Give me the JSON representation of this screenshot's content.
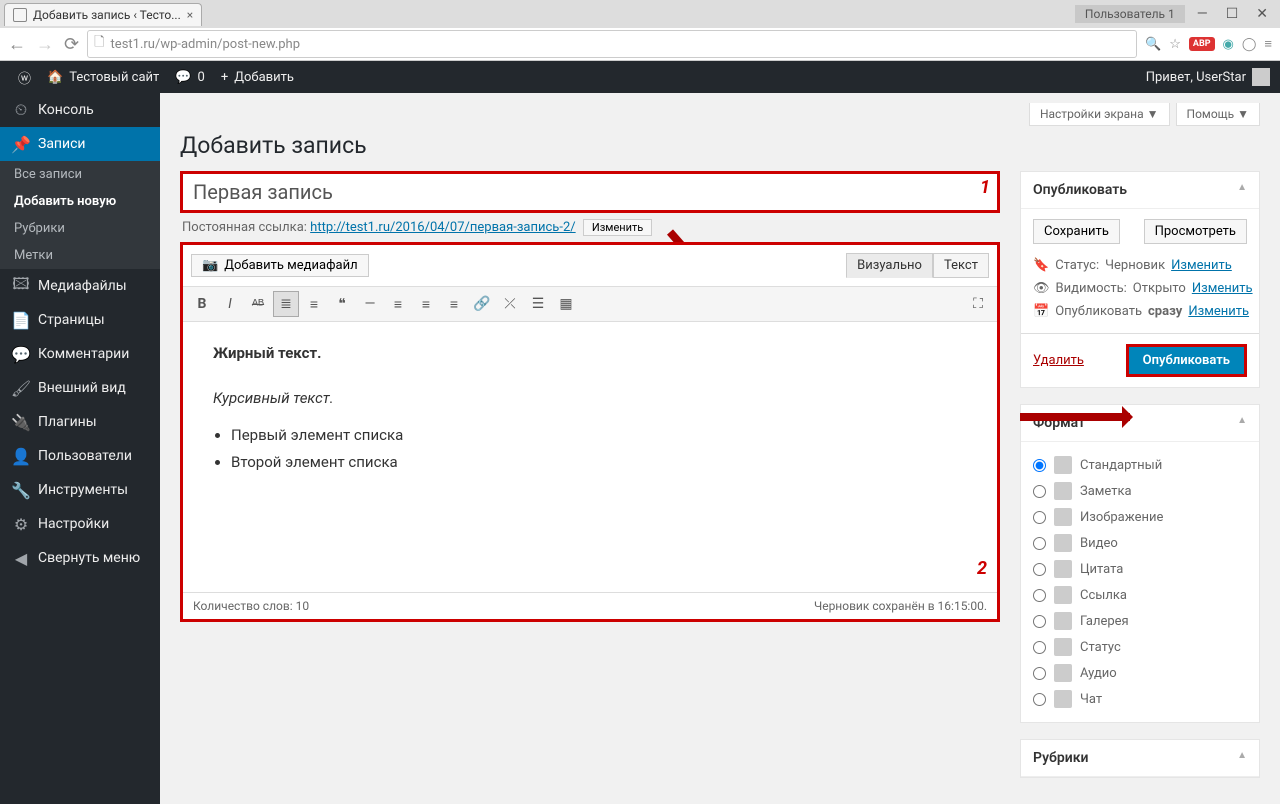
{
  "browser": {
    "tab_title": "Добавить запись ‹ Тесто...",
    "user_badge": "Пользователь 1",
    "url": "test1.ru/wp-admin/post-new.php"
  },
  "adminbar": {
    "site_name": "Тестовый сайт",
    "comments": "0",
    "add": "Добавить",
    "greeting": "Привет, UserStar"
  },
  "sidebar": {
    "items": [
      {
        "label": "Консоль"
      },
      {
        "label": "Записи"
      },
      {
        "label": "Медиафайлы"
      },
      {
        "label": "Страницы"
      },
      {
        "label": "Комментарии"
      },
      {
        "label": "Внешний вид"
      },
      {
        "label": "Плагины"
      },
      {
        "label": "Пользователи"
      },
      {
        "label": "Инструменты"
      },
      {
        "label": "Настройки"
      },
      {
        "label": "Свернуть меню"
      }
    ],
    "submenu": [
      {
        "label": "Все записи"
      },
      {
        "label": "Добавить новую"
      },
      {
        "label": "Рубрики"
      },
      {
        "label": "Метки"
      }
    ]
  },
  "screen_meta": {
    "options": "Настройки экрана",
    "help": "Помощь"
  },
  "page": {
    "title": "Добавить запись",
    "post_title": "Первая запись",
    "permalink_label": "Постоянная ссылка:",
    "permalink_url": "http://test1.ru/2016/04/07/первая-запись-2/",
    "permalink_edit": "Изменить",
    "add_media": "Добавить медиафайл",
    "tab_visual": "Визуально",
    "tab_text": "Текст",
    "content_bold": "Жирный текст.",
    "content_italic": "Курсивный текст.",
    "content_li1": "Первый элемент списка",
    "content_li2": "Второй элемент списка",
    "word_count": "Количество слов: 10",
    "draft_saved": "Черновик сохранён в 16:15:00."
  },
  "publish": {
    "header": "Опубликовать",
    "save": "Сохранить",
    "preview": "Просмотреть",
    "status_label": "Статус:",
    "status_value": "Черновик",
    "visibility_label": "Видимость:",
    "visibility_value": "Открыто",
    "schedule_label": "Опубликовать",
    "schedule_value": "сразу",
    "edit": "Изменить",
    "delete": "Удалить",
    "submit": "Опубликовать"
  },
  "format": {
    "header": "Формат",
    "items": [
      "Стандартный",
      "Заметка",
      "Изображение",
      "Видео",
      "Цитата",
      "Ссылка",
      "Галерея",
      "Статус",
      "Аудио",
      "Чат"
    ]
  },
  "categories": {
    "header": "Рубрики"
  },
  "annotations": {
    "n1": "1",
    "n2": "2"
  }
}
